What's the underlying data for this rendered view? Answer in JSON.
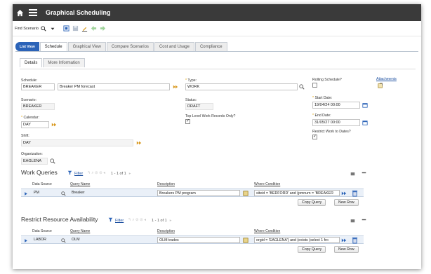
{
  "app": {
    "title": "Graphical Scheduling"
  },
  "toolbar": {
    "find_label": "Find Scenario"
  },
  "tabs": [
    "List View",
    "Schedule",
    "Graphical View",
    "Compare Scenarios",
    "Cost and Usage",
    "Compliance"
  ],
  "subtabs": [
    "Details",
    "More Information"
  ],
  "form": {
    "schedule_label": "Schedule:",
    "schedule_value": "BREAKER",
    "schedule_desc": "Breaker PM forecast",
    "type_label": "Type:",
    "type_value": "WORK",
    "rolling_label": "Rolling Schedule?",
    "attachments_label": "Attachments",
    "scenario_label": "Scenario:",
    "scenario_value": "BREAKER",
    "status_label": "Status:",
    "status_value": "DRAFT",
    "start_label": "Start Date:",
    "start_value": "19/04/24 00:00",
    "calendar_label": "Calendar:",
    "calendar_value": "DAY",
    "top_level_label": "Top Level Work Records Only?",
    "end_label": "End Date:",
    "end_value": "31/05/27 00:00",
    "restrict_label": "Restrict Work to Dates?",
    "shift_label": "Shift:",
    "shift_value": "DAY",
    "org_label": "Organization:",
    "org_value": "EAGLENA"
  },
  "work_queries": {
    "title": "Work Queries",
    "filter_label": "Filter",
    "pagination": "1 - 1 of 1",
    "headers": [
      "Data Source",
      "Query Name",
      "Description",
      "Where Condition"
    ],
    "row": {
      "data_source": "PM",
      "query_name": "Breaker",
      "description": "Breakers PM program",
      "where": "siteid = 'BEDFORD' and (pmnum = 'BREAKER"
    },
    "copy_label": "Copy Query",
    "new_label": "New Row"
  },
  "resource_availability": {
    "title": "Restrict Resource Availability",
    "filter_label": "Filter",
    "pagination": "1 - 1 of 1",
    "headers": [
      "Data Source",
      "Query Name",
      "Description",
      "Where Condition"
    ],
    "row": {
      "data_source": "LABOR",
      "query_name": "OLM",
      "description": "OLM trades",
      "where": "orgid = 'EAGLENA') and (exists (select 1 fro"
    },
    "copy_label": "Copy Query",
    "new_label": "New Row"
  },
  "colors": {
    "titlebar": "#3a3a3a",
    "active_tab": "#2b63b8",
    "link": "#1c4fa0"
  },
  "icons": [
    "home-icon",
    "menu-icon",
    "search-icon",
    "chevron-down-icon",
    "save-icon",
    "edit-icon",
    "back-arrow-icon",
    "forward-arrow-icon",
    "detail-menu-icon",
    "lookup-icon",
    "calendar-icon",
    "trash-icon",
    "expand-icon"
  ]
}
